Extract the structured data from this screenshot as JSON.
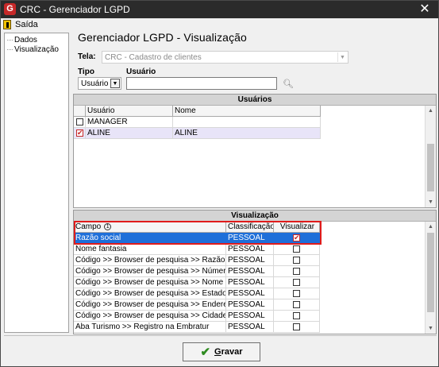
{
  "window": {
    "title": "CRC - Gerenciador LGPD",
    "app_icon": "G"
  },
  "menu": {
    "exit_label": "Saída"
  },
  "tree": {
    "items": [
      "Dados",
      "Visualização"
    ]
  },
  "header": {
    "title": "Gerenciador LGPD - Visualização"
  },
  "form": {
    "tela_label": "Tela:",
    "tela_value": "CRC - Cadastro de clientes",
    "tipo_label": "Tipo",
    "tipo_value": "Usuário",
    "usuario_label": "Usuário",
    "usuario_value": ""
  },
  "users_panel": {
    "title": "Usuários",
    "columns": [
      "Usuário",
      "Nome"
    ],
    "rows": [
      {
        "checked": false,
        "usuario": "MANAGER",
        "nome": ""
      },
      {
        "checked": true,
        "usuario": "ALINE",
        "nome": "ALINE"
      }
    ]
  },
  "vis_panel": {
    "title": "Visualização",
    "columns": [
      "Campo",
      "Classificação",
      "Visualizar"
    ],
    "info_badge": "1",
    "rows": [
      {
        "campo": "Razão social",
        "classificacao": "PESSOAL",
        "visualizar": true
      },
      {
        "campo": "Nome fantasia",
        "classificacao": "PESSOAL",
        "visualizar": false
      },
      {
        "campo": "Código >> Browser de pesquisa >> Razão Social",
        "classificacao": "PESSOAL",
        "visualizar": false
      },
      {
        "campo": "Código >> Browser de pesquisa >> Número",
        "classificacao": "PESSOAL",
        "visualizar": false
      },
      {
        "campo": "Código >> Browser de pesquisa >> Nome Fantasia",
        "classificacao": "PESSOAL",
        "visualizar": false
      },
      {
        "campo": "Código >> Browser de pesquisa >> Estado",
        "classificacao": "PESSOAL",
        "visualizar": false
      },
      {
        "campo": "Código >> Browser de pesquisa >> Endereço",
        "classificacao": "PESSOAL",
        "visualizar": false
      },
      {
        "campo": "Código >> Browser de pesquisa >> Cidade",
        "classificacao": "PESSOAL",
        "visualizar": false
      },
      {
        "campo": "Aba Turismo >> Registro na Embratur",
        "classificacao": "PESSOAL",
        "visualizar": false
      }
    ]
  },
  "footer": {
    "save_label": "Gravar",
    "save_hotkey_prefix": "G",
    "save_label_rest": "ravar"
  },
  "icons": {
    "app": "app-logo-icon",
    "exit": "exit-door-icon",
    "search": "binoculars-icon",
    "save": "check-icon",
    "close": "close-icon"
  },
  "colors": {
    "titlebar": "#2b2b2b",
    "selection": "#1e6fd9",
    "highlight_outline": "#e01b1b",
    "check_red": "#c62828",
    "save_check": "#2e8b20"
  }
}
